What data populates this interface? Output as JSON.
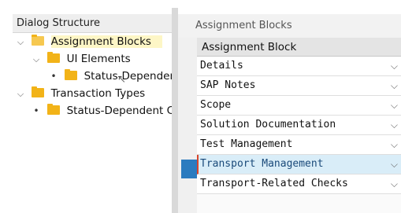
{
  "tree": {
    "header": "Dialog Structure",
    "nodes": [
      {
        "label": "Assignment Blocks",
        "expander": "⌵",
        "selected": true
      },
      {
        "label": "UI Elements",
        "expander": "⌵"
      },
      {
        "label": "Status-Dependent",
        "expander": "•"
      },
      {
        "label": "Transaction Types",
        "expander": "⌵"
      },
      {
        "label": "Status-Dependent Co",
        "expander": "•"
      }
    ]
  },
  "table": {
    "title": "Assignment Blocks",
    "column_header": "Assignment Block",
    "dropdown_glyph": "⌵",
    "rows": [
      {
        "value": "Details"
      },
      {
        "value": "SAP Notes"
      },
      {
        "value": "Scope"
      },
      {
        "value": "Solution Documentation"
      },
      {
        "value": "Test Management"
      },
      {
        "value": "Transport Management",
        "active": true
      },
      {
        "value": "Transport-Related Checks"
      }
    ]
  },
  "colors": {
    "folder": "#f2b318",
    "selection_highlight": "#fdf6c6",
    "active_row": "#d9edf8",
    "row_marker": "#2b7bbf",
    "edit_focus": "#d9452b"
  },
  "icons": [
    "expand-chevron-icon",
    "folder-icon",
    "bullet-icon",
    "mouse-cursor-icon",
    "dropdown-chevron-icon"
  ]
}
